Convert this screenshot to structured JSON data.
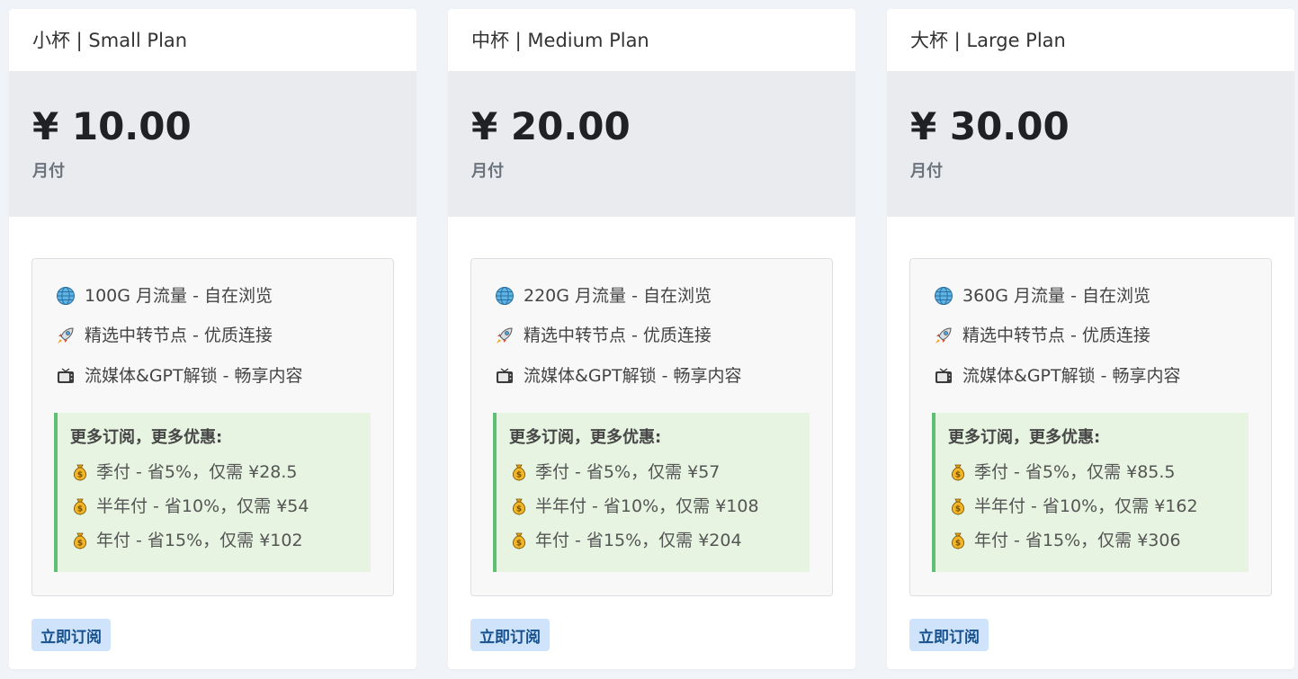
{
  "plans": [
    {
      "title": "小杯 | Small Plan",
      "price": "¥ 10.00",
      "period": "月付",
      "features": [
        {
          "icon": "globe-icon",
          "text": "100G 月流量 - 自在浏览"
        },
        {
          "icon": "rocket-icon",
          "text": "精选中转节点 - 优质连接"
        },
        {
          "icon": "tv-icon",
          "text": "流媒体&GPT解锁 - 畅享内容"
        }
      ],
      "promo_title": "更多订阅，更多优惠:",
      "promos": [
        {
          "icon": "money-bag-icon",
          "text": "季付 - 省5%，仅需 ¥28.5"
        },
        {
          "icon": "money-bag-icon",
          "text": "半年付 - 省10%，仅需 ¥54"
        },
        {
          "icon": "money-bag-icon",
          "text": "年付 - 省15%，仅需 ¥102"
        }
      ],
      "button": "立即订阅"
    },
    {
      "title": "中杯 | Medium Plan",
      "price": "¥ 20.00",
      "period": "月付",
      "features": [
        {
          "icon": "globe-icon",
          "text": "220G 月流量 - 自在浏览"
        },
        {
          "icon": "rocket-icon",
          "text": "精选中转节点 - 优质连接"
        },
        {
          "icon": "tv-icon",
          "text": "流媒体&GPT解锁 - 畅享内容"
        }
      ],
      "promo_title": "更多订阅，更多优惠:",
      "promos": [
        {
          "icon": "money-bag-icon",
          "text": "季付 - 省5%，仅需 ¥57"
        },
        {
          "icon": "money-bag-icon",
          "text": "半年付 - 省10%，仅需 ¥108"
        },
        {
          "icon": "money-bag-icon",
          "text": "年付 - 省15%，仅需 ¥204"
        }
      ],
      "button": "立即订阅"
    },
    {
      "title": "大杯 | Large Plan",
      "price": "¥ 30.00",
      "period": "月付",
      "features": [
        {
          "icon": "globe-icon",
          "text": "360G 月流量 - 自在浏览"
        },
        {
          "icon": "rocket-icon",
          "text": "精选中转节点 - 优质连接"
        },
        {
          "icon": "tv-icon",
          "text": "流媒体&GPT解锁 - 畅享内容"
        }
      ],
      "promo_title": "更多订阅，更多优惠:",
      "promos": [
        {
          "icon": "money-bag-icon",
          "text": "季付 - 省5%，仅需 ¥85.5"
        },
        {
          "icon": "money-bag-icon",
          "text": "半年付 - 省10%，仅需 ¥162"
        },
        {
          "icon": "money-bag-icon",
          "text": "年付 - 省15%，仅需 ¥306"
        }
      ],
      "button": "立即订阅"
    }
  ],
  "colors": {
    "page_background": "#f0f3f7",
    "price_band": "#e9ebef",
    "promo_background": "#e6f4e1",
    "promo_accent": "#5fbf75",
    "button_background": "#cfe4fb",
    "button_text": "#16508d"
  }
}
